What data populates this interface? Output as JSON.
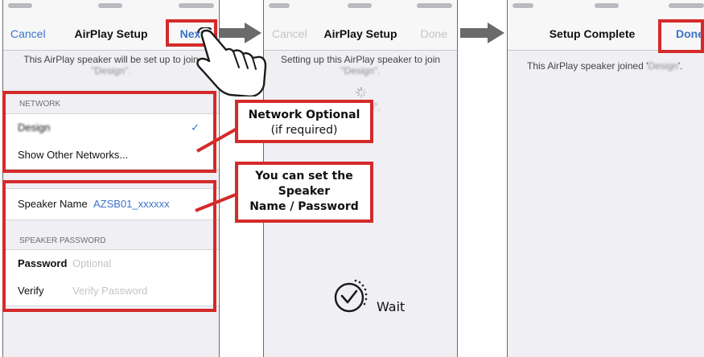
{
  "screen1": {
    "nav": {
      "cancel": "Cancel",
      "title": "AirPlay Setup",
      "next": "Next"
    },
    "message": "This AirPlay speaker will be set up to join",
    "network_name_blurred": "\"Design\".",
    "network_section": "NETWORK",
    "network_item": "Design",
    "show_other": "Show Other Networks...",
    "speaker_name_label": "Speaker Name",
    "speaker_name_value": "AZSB01_xxxxxx",
    "password_section": "SPEAKER PASSWORD",
    "password_label": "Password",
    "password_placeholder": "Optional",
    "verify_label": "Verify",
    "verify_placeholder": "Verify Password"
  },
  "screen2": {
    "nav": {
      "cancel": "Cancel",
      "title": "AirPlay Setup",
      "done": "Done"
    },
    "message": "Setting up this AirPlay speaker to join",
    "blur1": "\"Design\".",
    "blur2": "\"Design\".",
    "wait": "Wait"
  },
  "screen3": {
    "nav": {
      "title": "Setup Complete",
      "done": "Done"
    },
    "message": "This AirPlay speaker joined '",
    "blurred": "Design",
    "message_end": "'."
  },
  "callouts": {
    "network_title": "Network Optional",
    "network_sub": "(if required)",
    "speaker_line1": "You can set the",
    "speaker_line2": "Speaker",
    "speaker_line3": "Name / Password"
  },
  "colors": {
    "highlight": "#d42a2a",
    "ios_blue": "#3a73c9",
    "arrow": "#6a6a6a"
  }
}
